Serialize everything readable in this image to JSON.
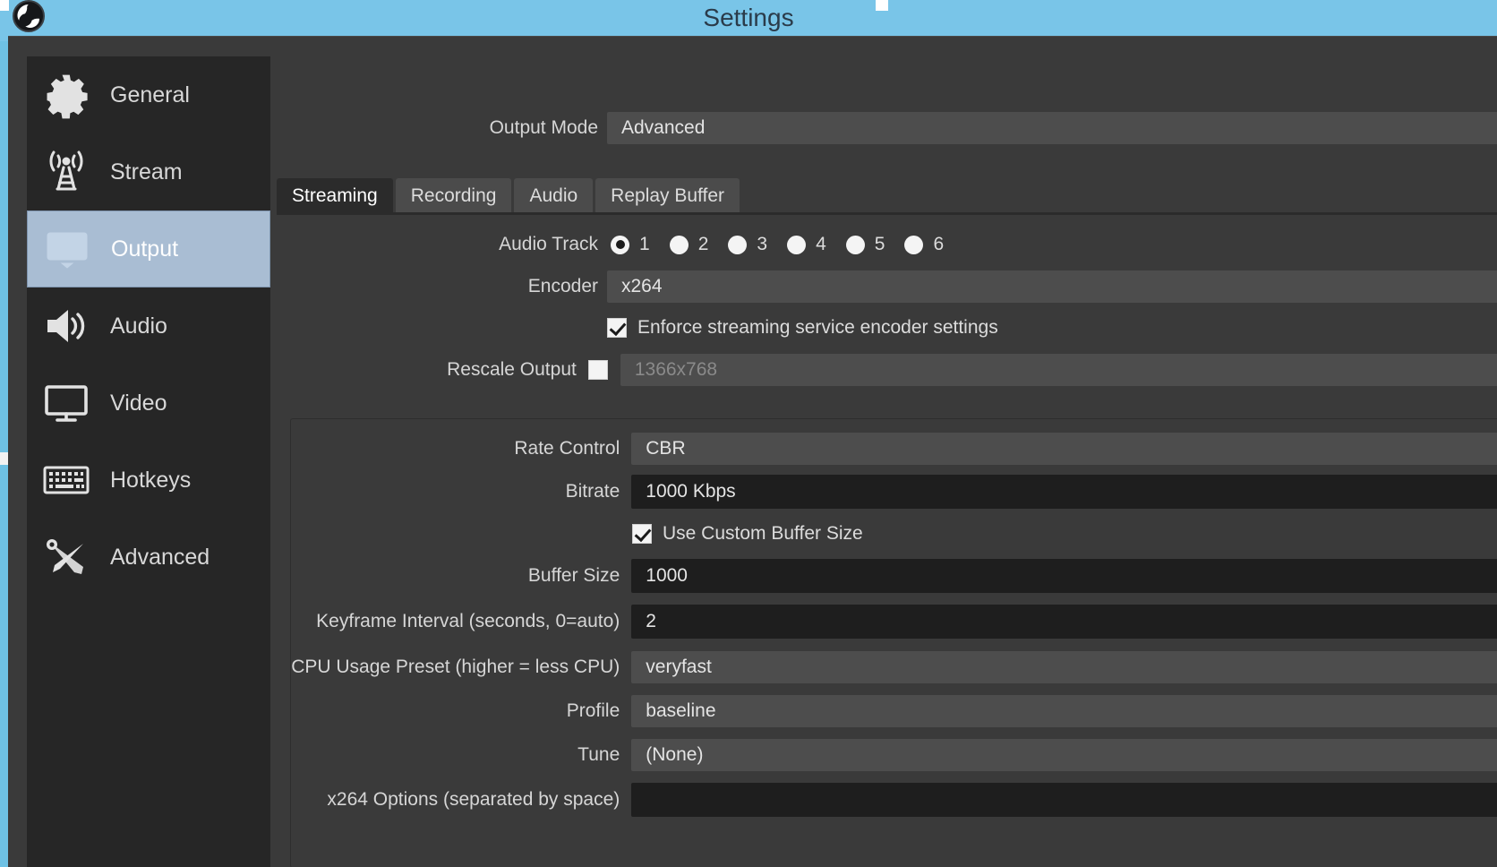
{
  "window": {
    "title": "Settings",
    "logo_name": "obs-logo",
    "accent_titlebar": "#79c5e8",
    "panel_bg": "#3a3a3a",
    "sidebar_bg": "#262626",
    "selected_bg": "#a9bdd3"
  },
  "sidebar": {
    "items": [
      {
        "label": "General",
        "icon": "gear-icon",
        "selected": false
      },
      {
        "label": "Stream",
        "icon": "broadcast-icon",
        "selected": false
      },
      {
        "label": "Output",
        "icon": "output-icon",
        "selected": true
      },
      {
        "label": "Audio",
        "icon": "speaker-icon",
        "selected": false
      },
      {
        "label": "Video",
        "icon": "monitor-icon",
        "selected": false
      },
      {
        "label": "Hotkeys",
        "icon": "keyboard-icon",
        "selected": false
      },
      {
        "label": "Advanced",
        "icon": "tools-icon",
        "selected": false
      }
    ]
  },
  "main": {
    "output_mode": {
      "label": "Output Mode",
      "value": "Advanced"
    },
    "tabs": [
      {
        "label": "Streaming",
        "active": true
      },
      {
        "label": "Recording",
        "active": false
      },
      {
        "label": "Audio",
        "active": false
      },
      {
        "label": "Replay Buffer",
        "active": false
      }
    ],
    "audio_track": {
      "label": "Audio Track",
      "options": [
        "1",
        "2",
        "3",
        "4",
        "5",
        "6"
      ],
      "selected": "1"
    },
    "encoder": {
      "label": "Encoder",
      "value": "x264"
    },
    "enforce": {
      "label": "Enforce streaming service encoder settings",
      "checked": true
    },
    "rescale": {
      "label": "Rescale Output",
      "checked": false,
      "value": "1366x768",
      "disabled": true
    },
    "rate_control": {
      "label": "Rate Control",
      "value": "CBR"
    },
    "bitrate": {
      "label": "Bitrate",
      "value": "1000 Kbps"
    },
    "custom_buffer": {
      "label": "Use Custom Buffer Size",
      "checked": true
    },
    "buffer_size": {
      "label": "Buffer Size",
      "value": "1000"
    },
    "keyframe": {
      "label": "Keyframe Interval (seconds, 0=auto)",
      "value": "2"
    },
    "cpu_preset": {
      "label": "CPU Usage Preset (higher = less CPU)",
      "value": "veryfast"
    },
    "profile": {
      "label": "Profile",
      "value": "baseline"
    },
    "tune": {
      "label": "Tune",
      "value": "(None)"
    },
    "x264_options": {
      "label": "x264 Options (separated by space)",
      "value": ""
    }
  }
}
